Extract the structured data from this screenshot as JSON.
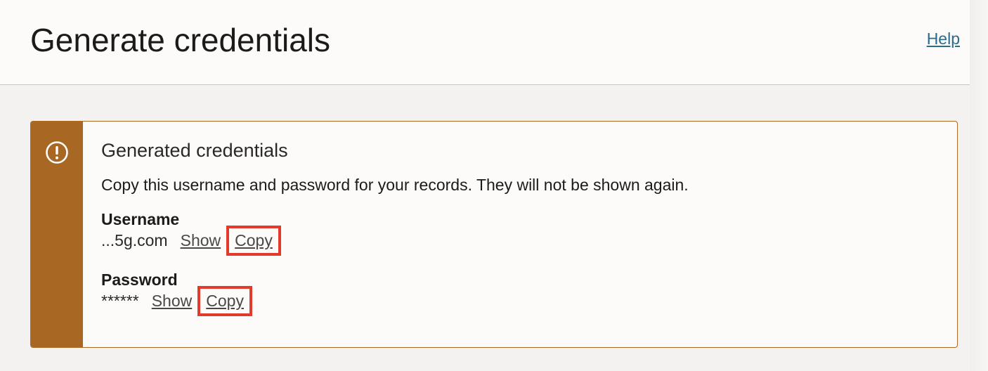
{
  "header": {
    "title": "Generate credentials",
    "help_label": "Help"
  },
  "alert": {
    "icon": "warning-circle-icon",
    "accent_color": "#a86723",
    "title": "Generated credentials",
    "description": "Copy this username and password for your records. They will not be shown again.",
    "username": {
      "label": "Username",
      "value": "...5g.com",
      "show_label": "Show",
      "copy_label": "Copy"
    },
    "password": {
      "label": "Password",
      "value": "******",
      "show_label": "Show",
      "copy_label": "Copy"
    }
  },
  "highlight_color": "#e33a2b"
}
